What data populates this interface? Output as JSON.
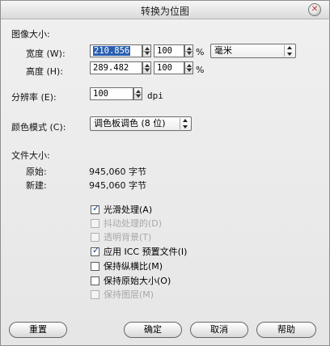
{
  "window": {
    "title": "转换为位图",
    "close_glyph": "✕"
  },
  "image_size": {
    "heading": "图像大小:",
    "width_label": "宽度 (W):",
    "width_value": "210.856",
    "width_percent": "100",
    "height_label": "高度 (H):",
    "height_value": "289.482",
    "height_percent": "100",
    "percent_symbol": "%",
    "unit_selected": "毫米"
  },
  "resolution": {
    "label": "分辨率 (E):",
    "value": "100",
    "unit": "dpi"
  },
  "color_mode": {
    "label": "颜色模式 (C):",
    "selected": "调色板调色 (8 位)"
  },
  "file_size": {
    "heading": "文件大小:",
    "original_label": "原始:",
    "original_value": "945,060 字节",
    "new_label": "新建:",
    "new_value": "945,060 字节"
  },
  "options": [
    {
      "label": "光滑处理(A)",
      "checked": true,
      "enabled": true
    },
    {
      "label": "抖动处理的(D)",
      "checked": false,
      "enabled": false
    },
    {
      "label": "透明背景(T)",
      "checked": false,
      "enabled": false
    },
    {
      "label": "应用 ICC 预置文件(I)",
      "checked": true,
      "enabled": true
    },
    {
      "label": "保持纵横比(M)",
      "checked": false,
      "enabled": true
    },
    {
      "label": "保持原始大小(O)",
      "checked": false,
      "enabled": true
    },
    {
      "label": "保持图层(M)",
      "checked": false,
      "enabled": false
    }
  ],
  "buttons": {
    "reset": "重置",
    "ok": "确定",
    "cancel": "取消",
    "help": "帮助"
  },
  "icons": {
    "close": "close-icon",
    "checkmark": "checkmark-icon"
  }
}
